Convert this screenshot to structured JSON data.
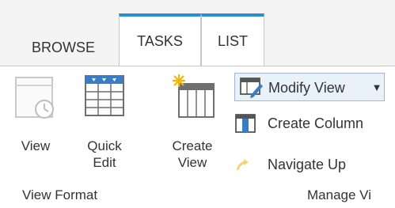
{
  "tabs": [
    {
      "label": "BROWSE",
      "selected": false
    },
    {
      "label": "TASKS",
      "selected": true
    },
    {
      "label": "LIST",
      "selected": true
    }
  ],
  "view_format": {
    "group_label": "View Format",
    "buttons": [
      {
        "label_line1": "View",
        "label_line2": "",
        "icon": "view-icon"
      },
      {
        "label_line1": "Quick",
        "label_line2": "Edit",
        "icon": "quick-edit-icon"
      },
      {
        "label_line1": "Create",
        "label_line2": "View",
        "icon": "create-view-icon"
      }
    ]
  },
  "manage_views": {
    "group_label": "Manage Vi",
    "buttons": [
      {
        "label": "Modify View",
        "icon": "modify-view-icon",
        "has_dropdown": true
      },
      {
        "label": "Create Column",
        "icon": "create-column-icon"
      },
      {
        "label": "Navigate Up",
        "icon": "navigate-up-icon"
      }
    ]
  },
  "colors": {
    "accent": "#2a8dd4",
    "tab_bar": "#f4f4f4",
    "hover_fill": "#e9f1f9"
  }
}
